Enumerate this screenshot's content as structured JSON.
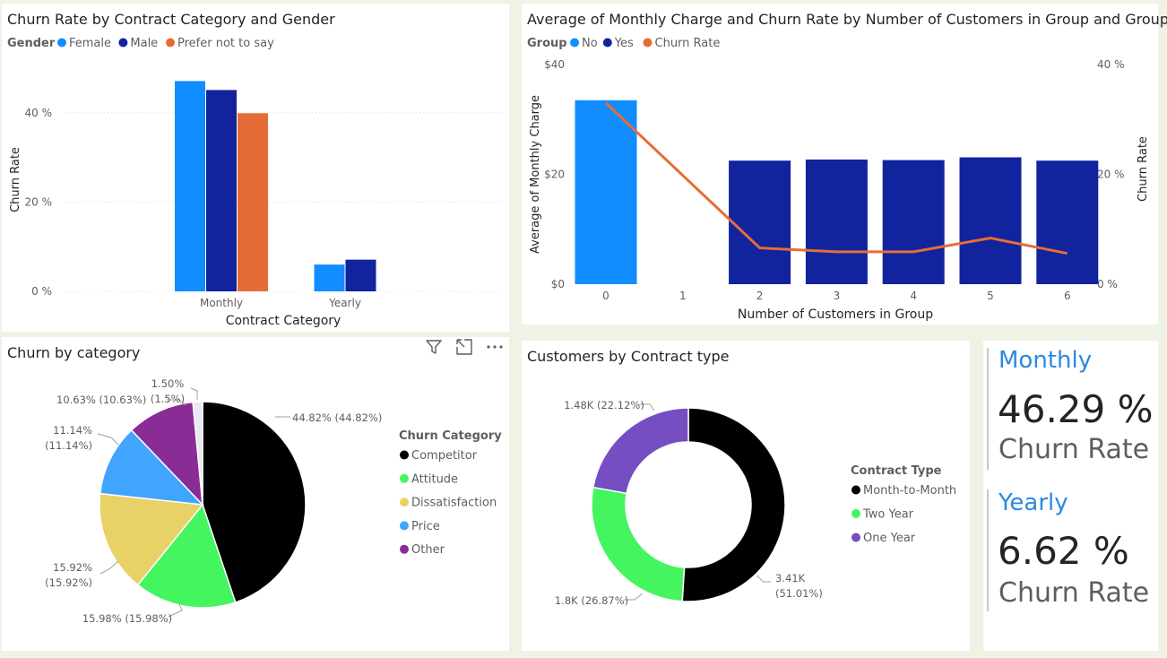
{
  "colors": {
    "light_blue": "#118dff",
    "dark_blue": "#12239e",
    "orange": "#e66c37",
    "black": "#000000",
    "green": "#45f560",
    "yellow": "#e8d166",
    "price_blue": "#41a4ff",
    "purple": "#8a2c96",
    "violet": "#744ec2"
  },
  "chart_data": [
    {
      "id": "churn-by-contract-gender",
      "type": "bar",
      "title": "Churn Rate by Contract Category and Gender",
      "legend_title": "Gender",
      "xlabel": "Contract Category",
      "ylabel": "Churn Rate",
      "categories": [
        "Monthly",
        "Yearly"
      ],
      "series": [
        {
          "name": "Female",
          "color": "#118dff",
          "values": [
            47.1,
            6.0
          ]
        },
        {
          "name": "Male",
          "color": "#12239e",
          "values": [
            45.1,
            7.1
          ]
        },
        {
          "name": "Prefer not to say",
          "color": "#e66c37",
          "values": [
            39.9,
            null
          ]
        }
      ],
      "ylim": [
        0,
        50
      ],
      "yticks": [
        "0 %",
        "20 %",
        "40 %"
      ],
      "ytick_values": [
        0,
        20,
        40
      ],
      "grid": true,
      "legend_position": "top-left"
    },
    {
      "id": "monthly-charge-churn-by-group",
      "type": "bar",
      "title": "Average of Monthly Charge and Churn Rate by Number of Customers in Group and Group",
      "legend_title": "Group",
      "xlabel": "Number of Customers in Group",
      "ylabel": "Average of Monthly Charge",
      "y2label": "Churn Rate",
      "categories": [
        "0",
        "1",
        "2",
        "3",
        "4",
        "5",
        "6"
      ],
      "series": [
        {
          "name": "No",
          "color": "#118dff",
          "type": "bar",
          "values": [
            33.5,
            null,
            null,
            null,
            null,
            null,
            null
          ]
        },
        {
          "name": "Yes",
          "color": "#12239e",
          "type": "bar",
          "values": [
            null,
            null,
            22.5,
            22.7,
            22.6,
            23.1,
            22.5
          ]
        },
        {
          "name": "Churn Rate",
          "color": "#e66c37",
          "type": "line",
          "axis": "right",
          "points": [
            [
              0,
              33.0
            ],
            [
              2,
              6.6
            ],
            [
              3,
              5.9
            ],
            [
              4,
              5.9
            ],
            [
              5,
              8.4
            ],
            [
              6,
              5.6
            ]
          ]
        }
      ],
      "ylim": [
        0,
        40
      ],
      "yticks": [
        "$0",
        "$20",
        "$40"
      ],
      "ytick_values": [
        0,
        20,
        40
      ],
      "y2lim": [
        0,
        40
      ],
      "y2ticks": [
        "0 %",
        "20 %",
        "40 %"
      ],
      "y2tick_values": [
        0,
        20,
        40
      ],
      "legend_position": "top-left"
    },
    {
      "id": "churn-by-category",
      "type": "pie",
      "title": "Churn by category",
      "legend_title": "Churn Category",
      "slices": [
        {
          "name": "Competitor",
          "value": 44.82,
          "color": "#000000",
          "label": "44.82% (44.82%)"
        },
        {
          "name": "Attitude",
          "value": 15.98,
          "color": "#45f560",
          "label": "15.98% (15.98%)"
        },
        {
          "name": "Dissatisfaction",
          "value": 15.92,
          "color": "#e8d166",
          "label": "15.92%\n(15.92%)"
        },
        {
          "name": "Price",
          "value": 11.14,
          "color": "#41a4ff",
          "label": "11.14%\n(11.14%)"
        },
        {
          "name": "Other",
          "value": 10.63,
          "color": "#8a2c96",
          "label": "10.63% (10.63%)"
        },
        {
          "name": "",
          "value": 1.5,
          "color": "#e9e9f3",
          "label": "1.50%\n(1.5%)"
        }
      ],
      "legend_position": "right"
    },
    {
      "id": "customers-by-contract-type",
      "type": "pie",
      "title": "Customers by Contract type",
      "legend_title": "Contract Type",
      "donut": true,
      "slices": [
        {
          "name": "Month-to-Month",
          "value": 51.01,
          "color": "#000000",
          "label": "3.41K\n(51.01%)"
        },
        {
          "name": "Two Year",
          "value": 26.87,
          "color": "#45f560",
          "label": "1.8K (26.87%)"
        },
        {
          "name": "One Year",
          "value": 22.12,
          "color": "#744ec2",
          "label": "1.48K (22.12%)"
        }
      ],
      "legend_position": "right"
    }
  ],
  "kpis": {
    "monthly": {
      "title": "Monthly",
      "value": "46.29 %",
      "label": "Churn Rate"
    },
    "yearly": {
      "title": "Yearly",
      "value": "6.62 %",
      "label": "Churn Rate"
    }
  },
  "icons": [
    "filter-icon",
    "focus-mode-icon",
    "more-options-icon"
  ]
}
